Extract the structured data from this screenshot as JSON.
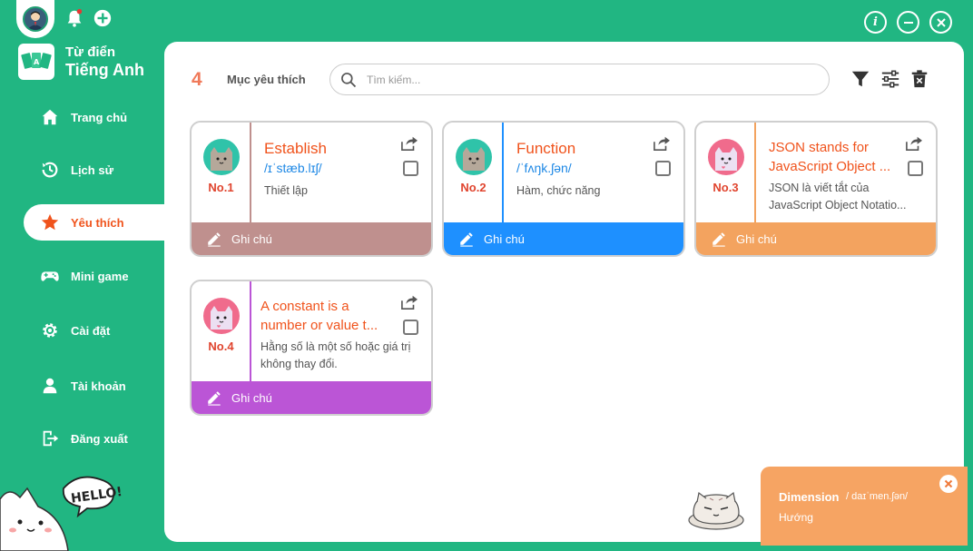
{
  "app": {
    "brand_line1": "Từ điển",
    "brand_line2": "Tiếng Anh"
  },
  "sidebar": {
    "items": [
      {
        "label": "Trang chủ",
        "icon": "home-icon",
        "active": false
      },
      {
        "label": "Lịch sử",
        "icon": "history-icon",
        "active": false
      },
      {
        "label": "Yêu thích",
        "icon": "star-icon",
        "active": true
      },
      {
        "label": "Mini game",
        "icon": "gamepad-icon",
        "active": false
      },
      {
        "label": "Cài đặt",
        "icon": "gear-icon",
        "active": false
      },
      {
        "label": "Tài khoản",
        "icon": "user-icon",
        "active": false
      },
      {
        "label": "Đăng xuất",
        "icon": "logout-icon",
        "active": false
      }
    ]
  },
  "header": {
    "count": "4",
    "title": "Mục yêu thích",
    "search_placeholder": "Tìm kiếm..."
  },
  "cards": [
    {
      "no": "No.1",
      "word": "Establish",
      "pron": "/ɪˈstæb.lɪʃ/",
      "meaning": "Thiết lập",
      "note_label": "Ghi chú",
      "accent": "#bf908e",
      "cat": "teal"
    },
    {
      "no": "No.2",
      "word": "Function",
      "pron": "/ˈfʌŋk.ʃən/",
      "meaning": "Hàm, chức năng",
      "note_label": "Ghi chú",
      "accent": "#1e90ff",
      "cat": "teal"
    },
    {
      "no": "No.3",
      "word": "JSON stands for JavaScript Object ...",
      "pron": "",
      "meaning": "JSON là viết tắt của JavaScript Object Notatio...",
      "note_label": "Ghi chú",
      "accent": "#f3a35f",
      "cat": "pink"
    },
    {
      "no": "No.4",
      "word": "A constant is a number or value t...",
      "pron": "",
      "meaning": "Hằng số là một số hoặc giá trị không thay đổi.",
      "note_label": "Ghi chú",
      "accent": "#bb55d6",
      "cat": "pink"
    }
  ],
  "popup": {
    "word": "Dimension",
    "pron": "/ daɪˈmen.ʃən/",
    "meaning": "Hướng"
  },
  "colors": {
    "primary": "#21b682",
    "active_text": "#f0531c",
    "popup": "#f6a463"
  }
}
